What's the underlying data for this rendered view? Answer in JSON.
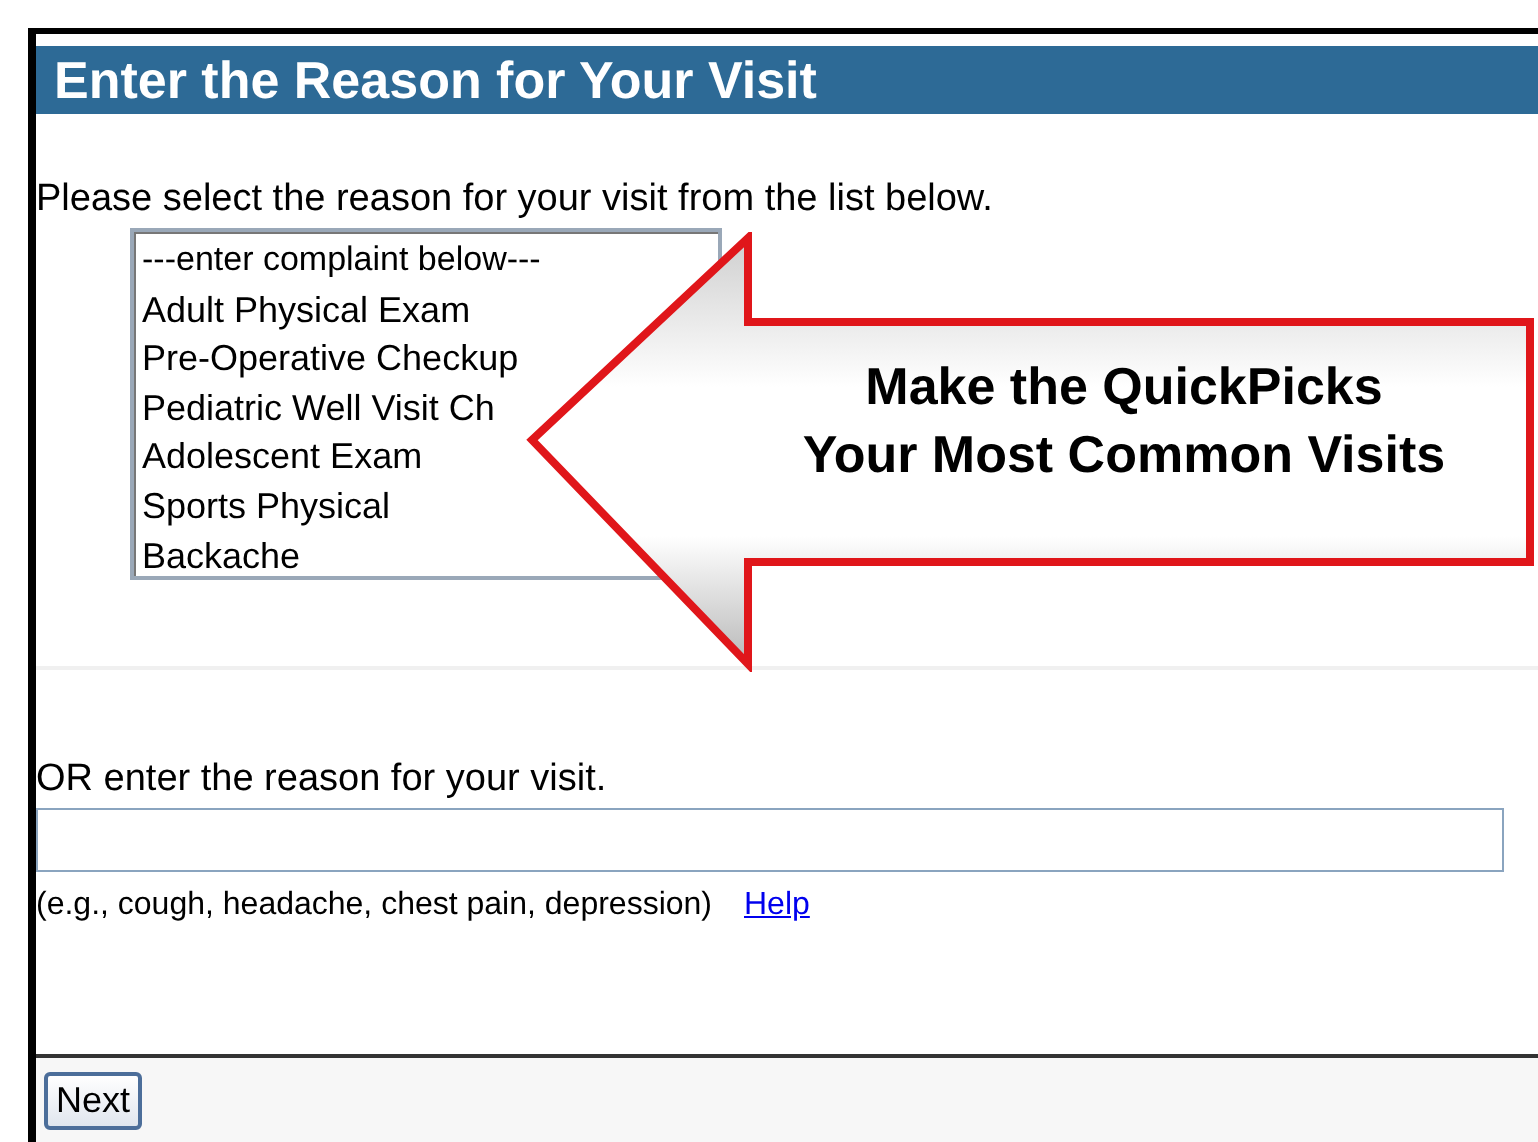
{
  "header": {
    "title": "Enter the Reason for Your Visit"
  },
  "instruction": "Please select the reason for your visit from the list below.",
  "quickpicks": {
    "items": [
      "---enter complaint below---",
      "Adult Physical Exam",
      "Pre-Operative Checkup",
      "Pediatric Well Visit Ch",
      "Adolescent Exam",
      "Sports Physical",
      "Backache"
    ]
  },
  "callout": {
    "lines": [
      "Make the QuickPicks",
      "Your Most Common Visits"
    ]
  },
  "reason_entry": {
    "label": "OR enter the reason for your visit.",
    "hint": "(e.g., cough, headache, chest pain, depression)",
    "help_link": "Help"
  },
  "footer": {
    "buttons": [
      "Next"
    ]
  }
}
